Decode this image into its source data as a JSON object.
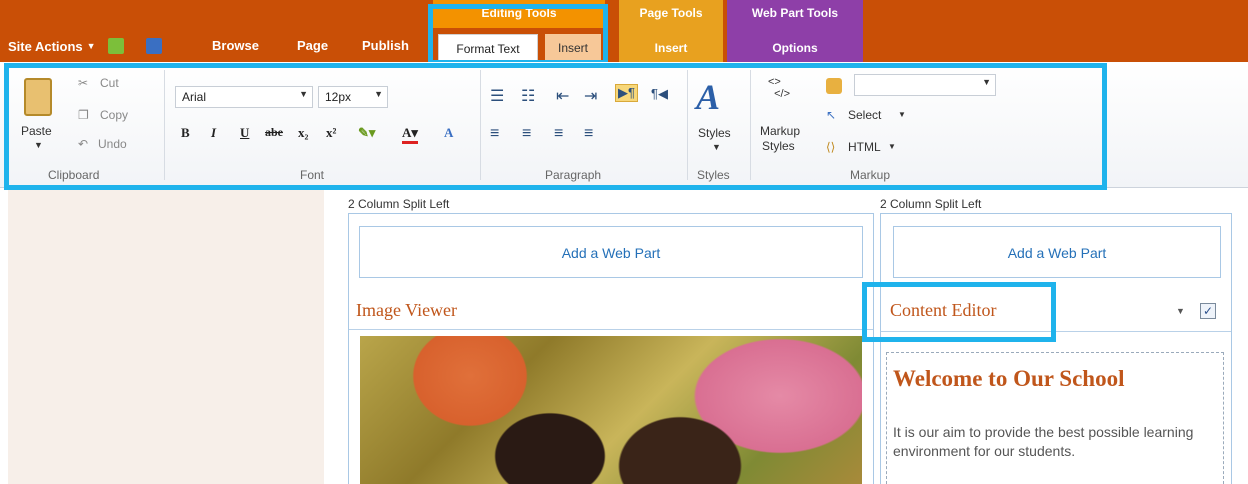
{
  "topnav": {
    "site_actions": "Site Actions",
    "tabs": [
      "Browse",
      "Page",
      "Publish"
    ]
  },
  "context_groups": [
    {
      "header": "Editing Tools",
      "tabs": [
        "Format Text",
        "Insert"
      ]
    },
    {
      "header": "Page Tools",
      "tabs": [
        "Insert"
      ]
    },
    {
      "header": "Web Part Tools",
      "tabs": [
        "Options"
      ]
    }
  ],
  "ribbon": {
    "clipboard": {
      "paste": "Paste",
      "cut": "Cut",
      "copy": "Copy",
      "undo": "Undo",
      "label": "Clipboard"
    },
    "font": {
      "family": "Arial",
      "size": "12px",
      "bold": "B",
      "italic": "I",
      "underline": "U",
      "strike": "abe",
      "subscript": "x₂",
      "superscript": "x²",
      "label": "Font"
    },
    "paragraph": {
      "label": "Paragraph"
    },
    "styles": {
      "button": "Styles",
      "label": "Styles"
    },
    "markup": {
      "markup_styles_line1": "Markup",
      "markup_styles_line2": "Styles",
      "select": "Select",
      "html": "HTML",
      "label": "Markup"
    }
  },
  "zones": {
    "left": {
      "title": "2 Column Split Left",
      "add_web_part": "Add a Web Part",
      "web_part_title": "Image Viewer"
    },
    "right": {
      "title": "2 Column Split Left",
      "add_web_part": "Add a Web Part",
      "web_part_title": "Content Editor"
    }
  },
  "content_editor": {
    "heading": "Welcome to Our School",
    "body": "It is our aim to provide the best possible learning environment for our students."
  },
  "colors": {
    "ribbon_orange": "#c94f06",
    "editing_tools": "#f39200",
    "page_tools": "#e8a11f",
    "web_part_tools": "#8e3fa8",
    "highlight_blue": "#1fb3ec"
  }
}
